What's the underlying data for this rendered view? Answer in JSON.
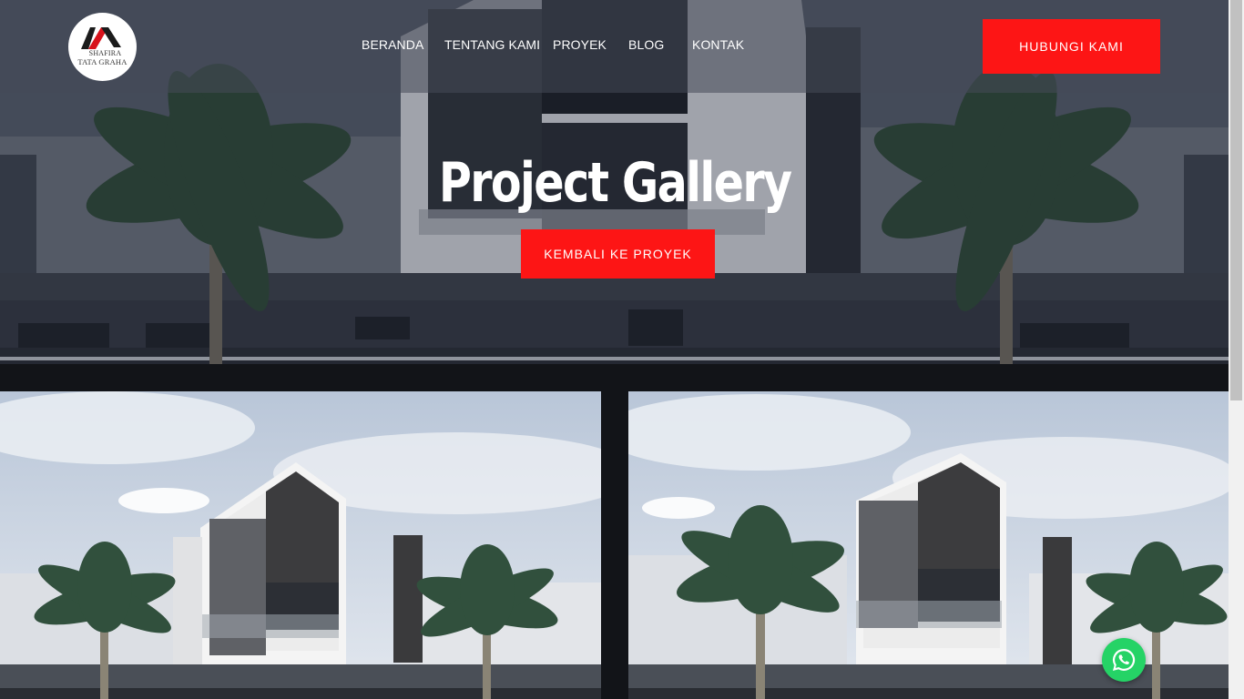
{
  "brand": {
    "line1": "SHAFIRA",
    "line2": "TATA GRAHA",
    "accent": "#fd1515",
    "logo_icon": "house-roof-logo"
  },
  "nav": {
    "items": [
      {
        "label": "BERANDA"
      },
      {
        "label": "TENTANG KAMI"
      },
      {
        "label": "PROYEK"
      },
      {
        "label": "BLOG"
      },
      {
        "label": "KONTAK"
      }
    ],
    "cta_label": "HUBUNGI KAMI"
  },
  "hero": {
    "title": "Project Gallery",
    "button_label": "KEMBALI KE PROYEK"
  },
  "gallery": {
    "items": [
      {
        "icon": "house-render-image"
      },
      {
        "icon": "house-render-image"
      }
    ]
  },
  "floating": {
    "whatsapp_icon": "whatsapp-icon",
    "whatsapp_color": "#25d366"
  }
}
